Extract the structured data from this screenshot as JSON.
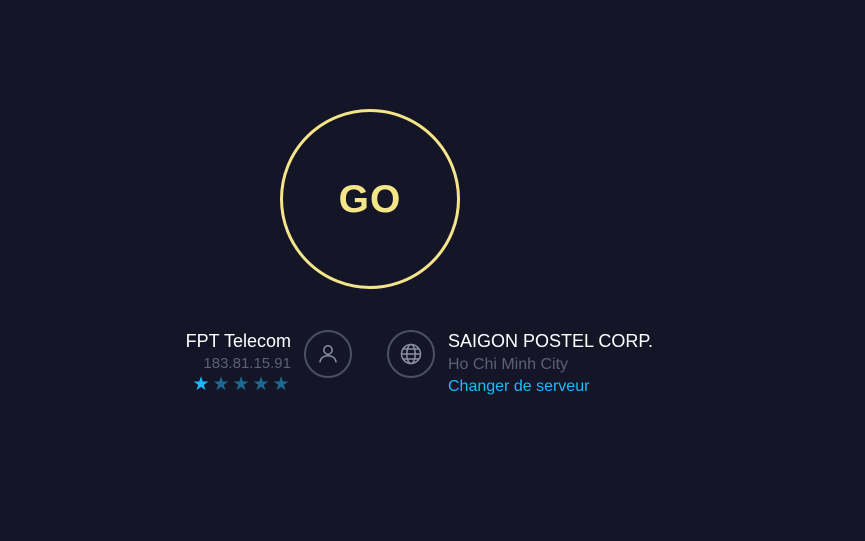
{
  "start": {
    "label": "GO",
    "accent_color": "#f5e58a"
  },
  "isp": {
    "name": "FPT Telecom",
    "ip": "183.81.15.91",
    "rating": 1,
    "rating_max": 5,
    "icon": "user-icon"
  },
  "server": {
    "name": "SAIGON POSTEL CORP.",
    "city": "Ho Chi Minh City",
    "change_label": "Changer de serveur",
    "icon": "globe-icon"
  },
  "colors": {
    "background": "#141627",
    "link": "#1fb8ff",
    "muted": "#5c6074"
  }
}
